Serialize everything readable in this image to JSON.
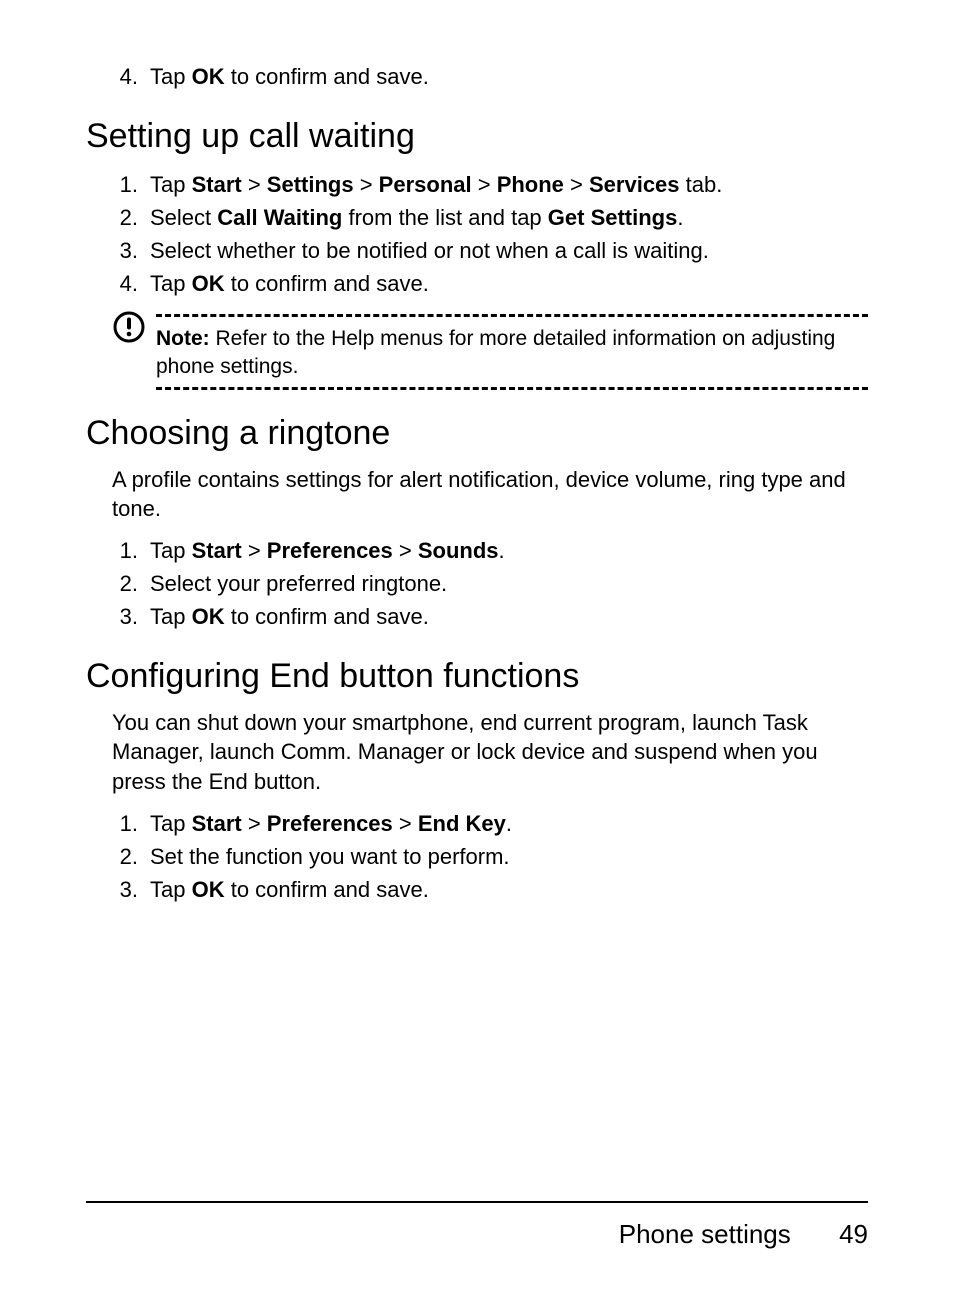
{
  "topFragment": {
    "num": "4.",
    "pre": "Tap ",
    "bold": "OK",
    "post": " to confirm and save."
  },
  "callWaiting": {
    "heading": "Setting up call waiting",
    "steps": [
      {
        "num": "1.",
        "parts": [
          {
            "t": "Tap "
          },
          {
            "b": "Start"
          },
          {
            "t": " > "
          },
          {
            "b": "Settings"
          },
          {
            "t": " > "
          },
          {
            "b": "Personal"
          },
          {
            "t": " > "
          },
          {
            "b": "Phone"
          },
          {
            "t": " > "
          },
          {
            "b": "Services"
          },
          {
            "t": " tab."
          }
        ]
      },
      {
        "num": "2.",
        "parts": [
          {
            "t": "Select "
          },
          {
            "b": "Call Waiting"
          },
          {
            "t": " from the list and tap "
          },
          {
            "b": "Get Settings"
          },
          {
            "t": "."
          }
        ]
      },
      {
        "num": "3.",
        "parts": [
          {
            "t": "Select whether to be notified or not when a call is waiting."
          }
        ]
      },
      {
        "num": "4.",
        "parts": [
          {
            "t": "Tap "
          },
          {
            "b": "OK"
          },
          {
            "t": " to confirm and save."
          }
        ]
      }
    ],
    "note": {
      "label": "Note:",
      "body": " Refer to the Help menus for more detailed information on adjusting phone settings."
    }
  },
  "ringtone": {
    "heading": "Choosing a ringtone",
    "intro": "A profile contains settings for alert notification, device volume, ring type and tone.",
    "steps": [
      {
        "num": "1.",
        "parts": [
          {
            "t": "Tap "
          },
          {
            "b": "Start"
          },
          {
            "t": " > "
          },
          {
            "b": "Preferences"
          },
          {
            "t": " > "
          },
          {
            "b": "Sounds"
          },
          {
            "t": "."
          }
        ]
      },
      {
        "num": "2.",
        "parts": [
          {
            "t": "Select your preferred ringtone."
          }
        ]
      },
      {
        "num": "3.",
        "parts": [
          {
            "t": "Tap "
          },
          {
            "b": "OK"
          },
          {
            "t": " to confirm and save."
          }
        ]
      }
    ]
  },
  "endButton": {
    "heading": "Configuring End button functions",
    "intro": "You can shut down your smartphone, end current program, launch Task Manager, launch Comm. Manager or lock device and suspend when you press the End button.",
    "steps": [
      {
        "num": "1.",
        "parts": [
          {
            "t": "Tap "
          },
          {
            "b": "Start"
          },
          {
            "t": " > "
          },
          {
            "b": "Preferences"
          },
          {
            "t": " > "
          },
          {
            "b": "End Key"
          },
          {
            "t": "."
          }
        ]
      },
      {
        "num": "2.",
        "parts": [
          {
            "t": "Set the function you want to perform."
          }
        ]
      },
      {
        "num": "3.",
        "parts": [
          {
            "t": "Tap "
          },
          {
            "b": "OK"
          },
          {
            "t": " to confirm and save."
          }
        ]
      }
    ]
  },
  "footer": {
    "section": "Phone settings",
    "page": "49"
  }
}
